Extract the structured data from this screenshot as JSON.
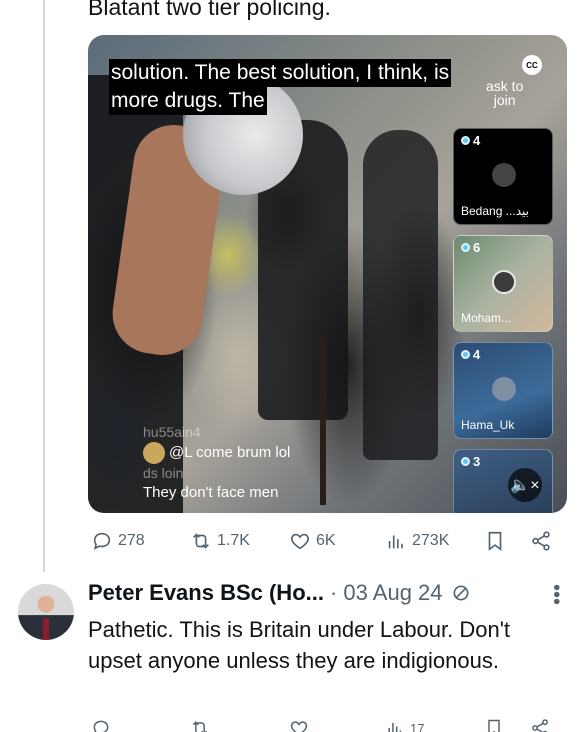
{
  "post": {
    "text": "Blatant two tier policing.",
    "video": {
      "caption_line1": "solution. The best solution, I think, is",
      "caption_line2": "more drugs. The",
      "cc_label": "CC",
      "ask_to_join": "ask to\njoin",
      "live_tiles": [
        {
          "count": "4",
          "name": "Bedang ...بيد"
        },
        {
          "count": "6",
          "name": "Moham..."
        },
        {
          "count": "4",
          "name": "Hama_Uk"
        },
        {
          "count": "3",
          "name": ""
        }
      ],
      "comments": [
        {
          "user": "hu55ain4",
          "text": "@L come brum lol"
        },
        {
          "user": "ds loin",
          "text": "They don't face men"
        }
      ]
    },
    "metrics": {
      "replies": "278",
      "reposts": "1.7K",
      "likes": "6K",
      "views": "273K"
    }
  },
  "reply": {
    "name": "Peter Evans BSc (Ho...",
    "date": "· 03 Aug 24",
    "body": "Pathetic.  This is Britain under Labour. Don't upset anyone unless they are indigionous.",
    "metrics": {
      "views": "17"
    }
  },
  "colors": {
    "text": "#0f1419",
    "muted": "#536471",
    "thread_line": "#cfd9de"
  }
}
